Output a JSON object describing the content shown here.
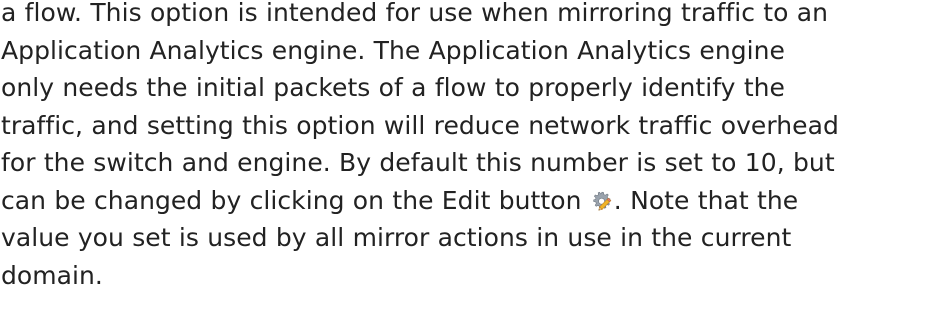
{
  "document": {
    "lines": [
      "a flow. This option is intended for use when mirroring traffic to an",
      "Application Analytics engine. The Application Analytics engine",
      "only needs the initial packets of a flow to properly identify the",
      "traffic, and setting this option will reduce network traffic overhead",
      "for the switch and engine. By default this number is set to 10, but",
      "can be changed by clicking on the Edit button",
      ". Note that the",
      "value you set is used by all mirror actions in use in the current",
      "domain."
    ],
    "inline_icon": "edit-gear-pencil-icon",
    "colors": {
      "text": "#222222",
      "gear": "#9aa3ad",
      "pencil": "#f0b429"
    }
  }
}
